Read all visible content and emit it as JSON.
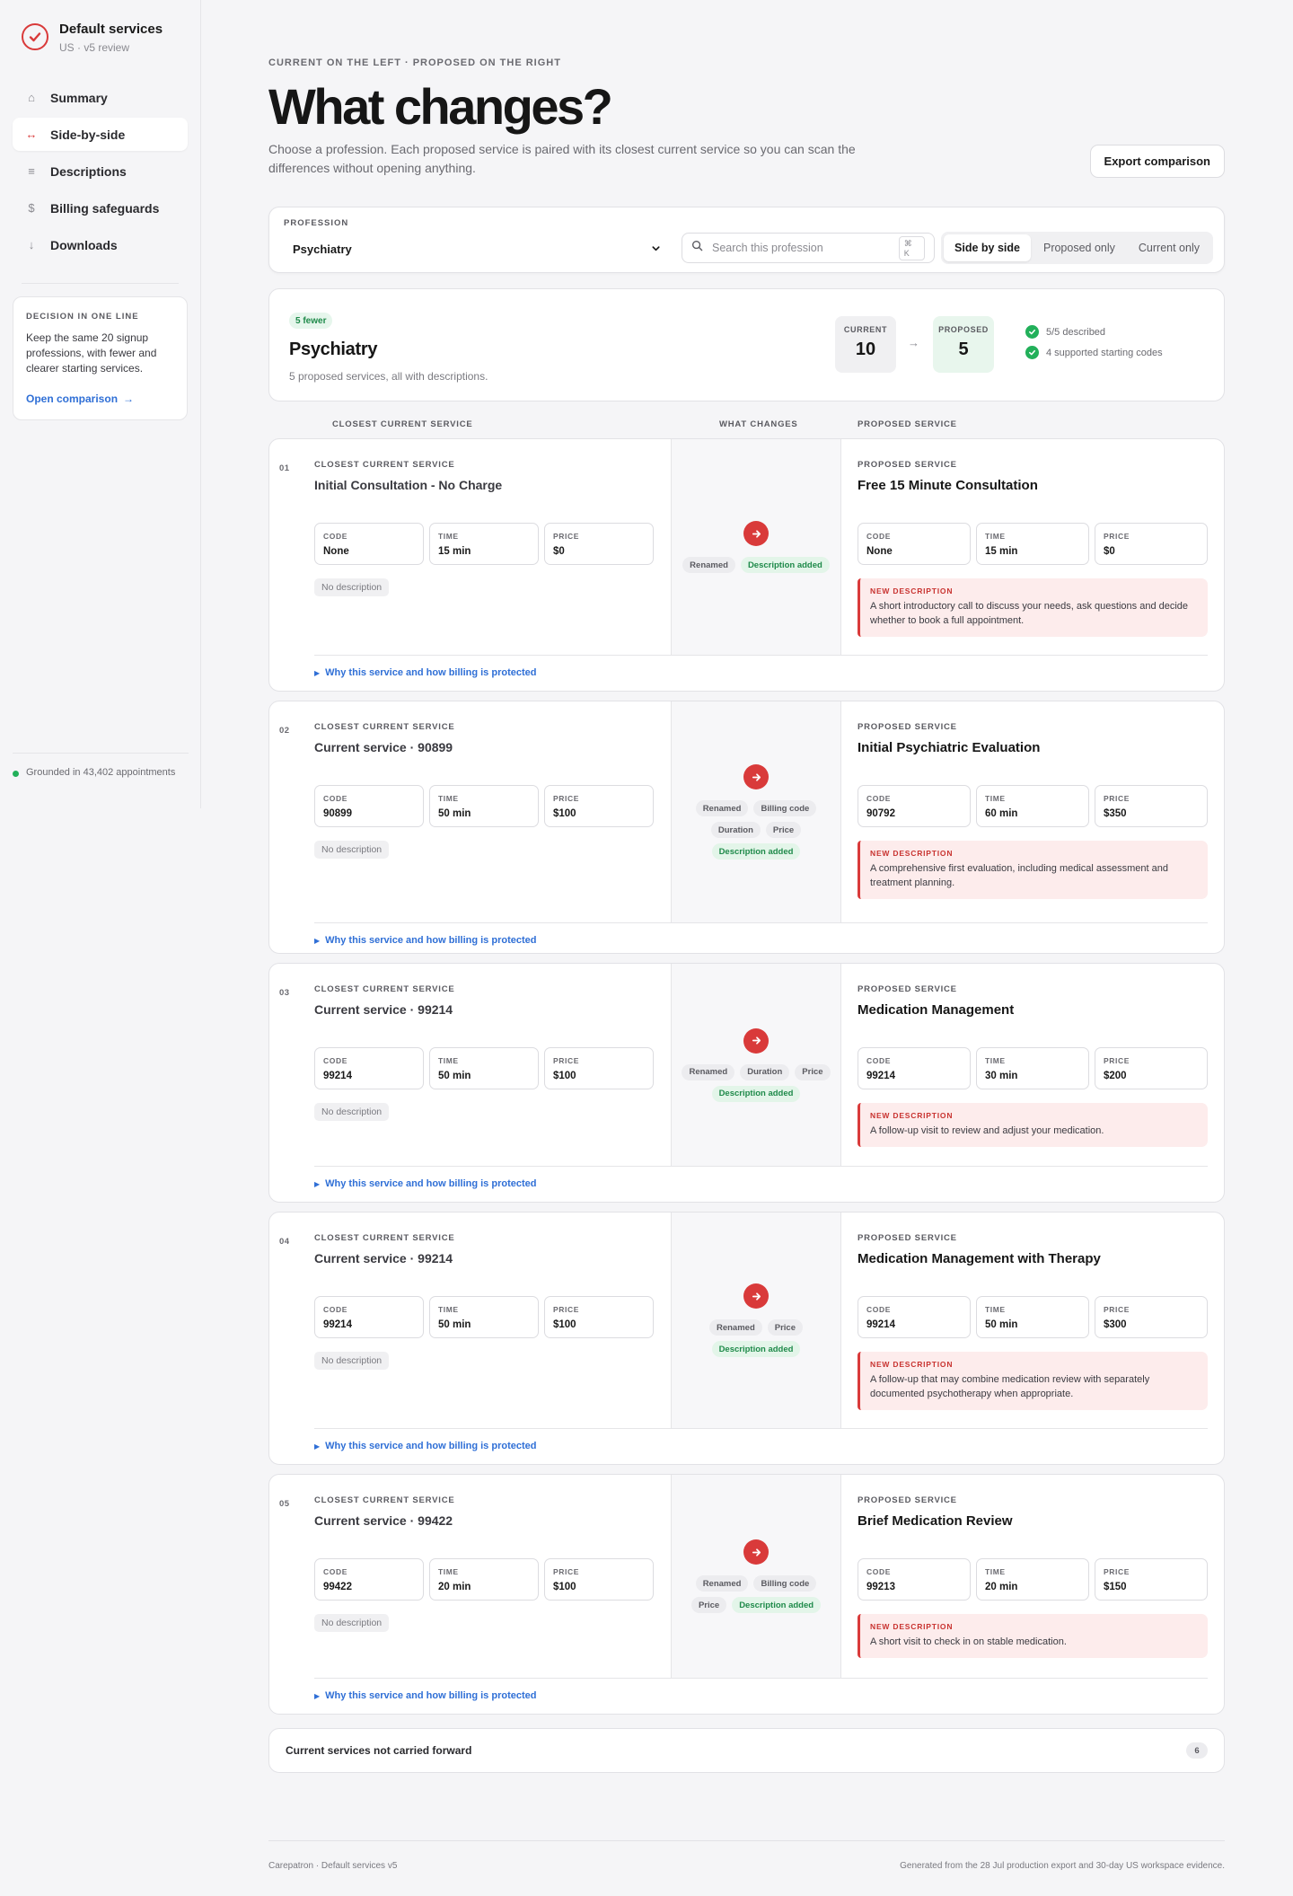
{
  "brand": {
    "title": "Default services",
    "subtitle": "US · v5 review"
  },
  "nav": [
    {
      "icon": "⌂",
      "label": "Summary"
    },
    {
      "icon": "↔",
      "label": "Side-by-side"
    },
    {
      "icon": "≡",
      "label": "Descriptions"
    },
    {
      "icon": "$",
      "label": "Billing safeguards"
    },
    {
      "icon": "↓",
      "label": "Downloads"
    }
  ],
  "decision": {
    "label": "DECISION IN ONE LINE",
    "text": "Keep the same 20 signup professions, with fewer and clearer starting services.",
    "link": "Open comparison"
  },
  "grounded": "Grounded in 43,402 appointments",
  "header": {
    "eyebrow": "CURRENT ON THE LEFT · PROPOSED ON THE RIGHT",
    "title": "What changes?",
    "lead": "Choose a profession. Each proposed service is paired with its closest current service so you can scan the differences without opening anything.",
    "export": "Export comparison"
  },
  "filter": {
    "profession_label": "PROFESSION",
    "profession_value": "Psychiatry",
    "search_placeholder": "Search this profession",
    "shortcut": "⌘ K",
    "views": [
      "Side by side",
      "Proposed only",
      "Current only"
    ]
  },
  "summary": {
    "badge": "5 fewer",
    "title": "Psychiatry",
    "subtitle": "5 proposed services, all with descriptions.",
    "current_label": "CURRENT",
    "current_value": "10",
    "proposed_label": "PROPOSED",
    "proposed_value": "5",
    "checks": [
      "5/5 described",
      "4 supported starting codes"
    ]
  },
  "columns": {
    "current": "CLOSEST CURRENT SERVICE",
    "changes": "WHAT CHANGES",
    "proposed": "PROPOSED SERVICE"
  },
  "labels": {
    "closest": "CLOSEST CURRENT SERVICE",
    "proposed": "PROPOSED SERVICE",
    "code": "CODE",
    "time": "TIME",
    "price": "PRICE",
    "no_desc": "No description",
    "new_desc": "NEW DESCRIPTION",
    "why": "Why this service and how billing is protected"
  },
  "services": [
    {
      "num": "01",
      "current": {
        "name": "Initial Consultation - No Charge",
        "code": "None",
        "time": "15 min",
        "price": "$0"
      },
      "changes": [
        "Renamed",
        "Description added"
      ],
      "proposed": {
        "name": "Free 15 Minute Consultation",
        "code": "None",
        "time": "15 min",
        "price": "$0",
        "description": "A short introductory call to discuss your needs, ask questions and decide whether to book a full appointment."
      }
    },
    {
      "num": "02",
      "current": {
        "name": "Current service · 90899",
        "code": "90899",
        "time": "50 min",
        "price": "$100"
      },
      "changes": [
        "Renamed",
        "Billing code",
        "Duration",
        "Price",
        "Description added"
      ],
      "proposed": {
        "name": "Initial Psychiatric Evaluation",
        "code": "90792",
        "time": "60 min",
        "price": "$350",
        "description": "A comprehensive first evaluation, including medical assessment and treatment planning."
      }
    },
    {
      "num": "03",
      "current": {
        "name": "Current service · 99214",
        "code": "99214",
        "time": "50 min",
        "price": "$100"
      },
      "changes": [
        "Renamed",
        "Duration",
        "Price",
        "Description added"
      ],
      "proposed": {
        "name": "Medication Management",
        "code": "99214",
        "time": "30 min",
        "price": "$200",
        "description": "A follow-up visit to review and adjust your medication."
      }
    },
    {
      "num": "04",
      "current": {
        "name": "Current service · 99214",
        "code": "99214",
        "time": "50 min",
        "price": "$100"
      },
      "changes": [
        "Renamed",
        "Price",
        "Description added"
      ],
      "proposed": {
        "name": "Medication Management with Therapy",
        "code": "99214",
        "time": "50 min",
        "price": "$300",
        "description": "A follow-up that may combine medication review with separately documented psychotherapy when appropriate."
      }
    },
    {
      "num": "05",
      "current": {
        "name": "Current service · 99422",
        "code": "99422",
        "time": "20 min",
        "price": "$100"
      },
      "changes": [
        "Renamed",
        "Billing code",
        "Price",
        "Description added"
      ],
      "proposed": {
        "name": "Brief Medication Review",
        "code": "99213",
        "time": "20 min",
        "price": "$150",
        "description": "A short visit to check in on stable medication."
      }
    }
  ],
  "not_carried": {
    "label": "Current services not carried forward",
    "count": "6"
  },
  "footer": {
    "left": "Carepatron · Default services v5",
    "right": "Generated from the 28 Jul production export and 30-day US workspace evidence."
  }
}
